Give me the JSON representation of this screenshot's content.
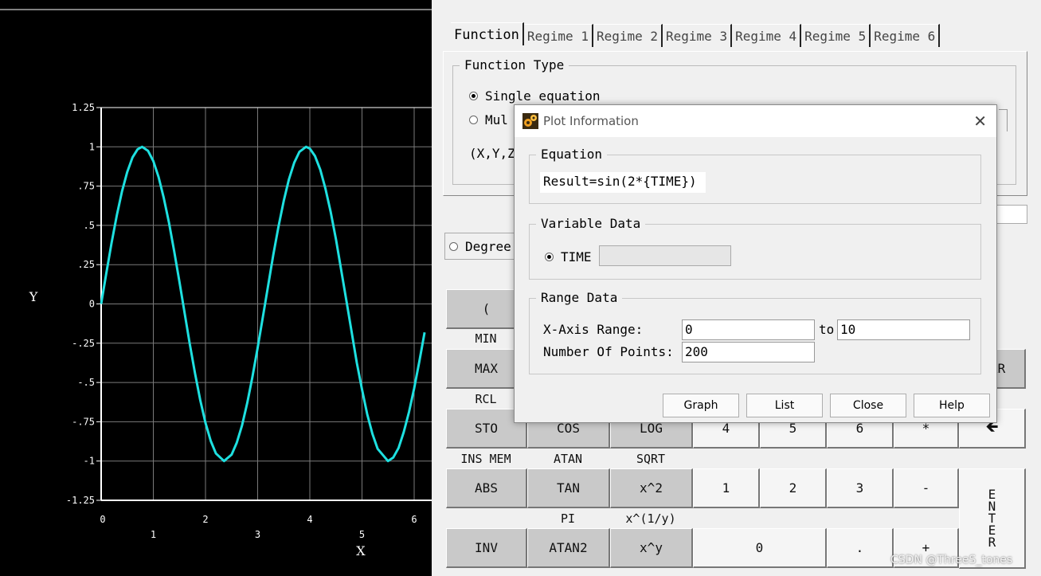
{
  "chart_data": {
    "type": "line",
    "xlabel": "X",
    "ylabel": "Y",
    "xlim": [
      0,
      6.2
    ],
    "ylim": [
      -1.25,
      1.25
    ],
    "x_ticks": [
      "0",
      "1",
      "2",
      "3",
      "4",
      "5",
      "6"
    ],
    "y_ticks": [
      "1.25",
      "1",
      ".75",
      ".5",
      ".25",
      "0",
      "-.25",
      "-.5",
      "-.75",
      "-1",
      "-1.25"
    ],
    "grid": true,
    "series": [
      {
        "color": "#1ee0e0",
        "x": [
          0,
          0.1,
          0.2,
          0.3,
          0.4,
          0.5,
          0.6,
          0.7,
          0.785,
          0.9,
          1.0,
          1.1,
          1.2,
          1.3,
          1.4,
          1.5,
          1.571,
          1.7,
          1.8,
          1.9,
          2.0,
          2.1,
          2.2,
          2.356,
          2.5,
          2.6,
          2.7,
          2.8,
          2.9,
          3.0,
          3.142,
          3.3,
          3.4,
          3.5,
          3.6,
          3.7,
          3.8,
          3.927,
          4.0,
          4.1,
          4.2,
          4.3,
          4.4,
          4.5,
          4.712,
          4.9,
          5.0,
          5.1,
          5.2,
          5.3,
          5.498,
          5.6,
          5.7,
          5.8,
          5.9,
          6.0,
          6.1,
          6.2
        ],
        "values": [
          0,
          0.199,
          0.389,
          0.565,
          0.717,
          0.841,
          0.932,
          0.985,
          1.0,
          0.974,
          0.909,
          0.808,
          0.675,
          0.516,
          0.335,
          0.141,
          0,
          -0.256,
          -0.443,
          -0.612,
          -0.757,
          -0.872,
          -0.952,
          -1.0,
          -0.959,
          -0.883,
          -0.773,
          -0.631,
          -0.465,
          -0.279,
          0,
          0.312,
          0.494,
          0.657,
          0.794,
          0.899,
          0.968,
          1.0,
          0.989,
          0.941,
          0.855,
          0.734,
          0.585,
          0.412,
          0,
          -0.375,
          -0.544,
          -0.701,
          -0.827,
          -0.922,
          -1.0,
          -0.977,
          -0.917,
          -0.816,
          -0.688,
          -0.537,
          -0.366,
          -0.181
        ]
      }
    ]
  },
  "panel": {
    "tabs": [
      "Function",
      "Regime 1",
      "Regime 2",
      "Regime 3",
      "Regime 4",
      "Regime 5",
      "Regime 6"
    ],
    "function_type": {
      "legend": "Function Type",
      "single": "Single equation",
      "multi_partial": "Mul",
      "vars_partial": "(X,Y,Z"
    },
    "degree_partial": "Degree"
  },
  "keypad": {
    "labels": {
      "min": "MIN",
      "rcl": "RCL",
      "ins_mem": "INS MEM",
      "atan": "ATAN",
      "sqrt": "SQRT",
      "pi": "PI",
      "x_pow_inv_y": "x^(1/y)"
    },
    "buttons": {
      "lparen": "(",
      "max": "MAX",
      "clear_partial": "AR",
      "sto": "STO",
      "cos": "COS",
      "log": "LOG",
      "n4": "4",
      "n5": "5",
      "n6": "6",
      "mult": "*",
      "backspace": "🡸",
      "abs": "ABS",
      "tan": "TAN",
      "x_sq": "x^2",
      "n1": "1",
      "n2": "2",
      "n3": "3",
      "minus": "-",
      "inv": "INV",
      "atan2": "ATAN2",
      "x_pow_y": "x^y",
      "n0": "0",
      "dot": ".",
      "plus": "+",
      "enter": [
        "E",
        "N",
        "T",
        "E",
        "R"
      ]
    }
  },
  "dialog": {
    "title": "Plot Information",
    "close": "✕",
    "equation": {
      "legend": "Equation",
      "text": "Result=sin(2*{TIME})"
    },
    "variable": {
      "legend": "Variable Data",
      "name": "TIME",
      "value": ""
    },
    "range": {
      "legend": "Range Data",
      "x_label": "X-Axis Range:",
      "x_from": "0",
      "to_label": "to",
      "x_to": "10",
      "points_label": "Number Of Points:",
      "points": "200"
    },
    "buttons": {
      "graph": "Graph",
      "list": "List",
      "close": "Close",
      "help": "Help"
    }
  },
  "watermark": "CSDN @ThreeS_tones"
}
